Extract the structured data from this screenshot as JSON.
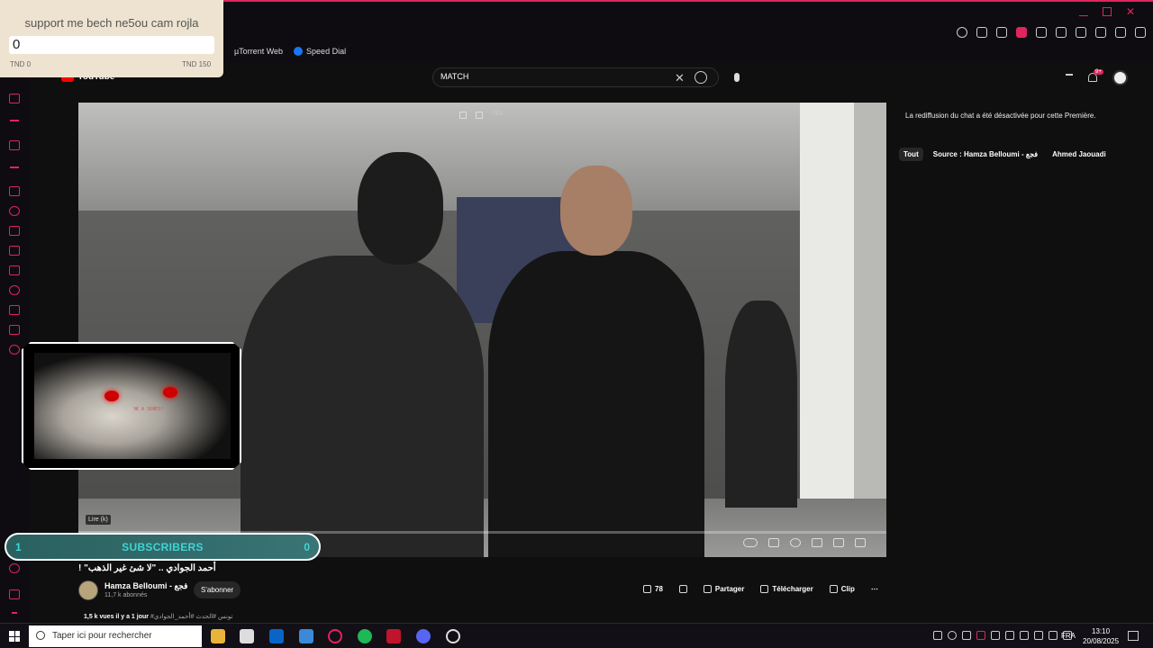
{
  "browser": {
    "bookmarks": [
      {
        "label": "µTorrent Web",
        "icon": "utorrent-icon"
      },
      {
        "label": "Speed Dial",
        "icon": "facebook-icon"
      }
    ]
  },
  "donation": {
    "title": "support me bech ne5ou cam rojla",
    "amount": "0",
    "min_label": "TND 0",
    "max_label": "TND 150"
  },
  "youtube": {
    "logo_text": "YouTube",
    "search_value": "MATCH",
    "notifications_badge": "9+"
  },
  "video": {
    "tooltip": "Lire (k)",
    "top_overlay_label": "ПЕХ",
    "title": "أحمد الجوادي .. \"لا شئ غير الذهب\" !",
    "views_line": "1,5 k vues  il y a 1 jour",
    "tags": "#تونس #الحدث #أحمد_الجوادي"
  },
  "channel": {
    "name": "Hamza Belloumi - فجع",
    "subs": "11,7 k abonnés",
    "subscribe_label": "S'abonner"
  },
  "actions": {
    "likes": "78",
    "share": "Partager",
    "download": "Télécharger",
    "clip": "Clip"
  },
  "chat": {
    "note": "La rediffusion du chat a été désactivée pour cette Première.",
    "chips": [
      "Tout",
      "Source : Hamza Belloumi - فجع",
      "Ahmed Jaouadi"
    ]
  },
  "stream_overlay": {
    "subs_left": "1",
    "subs_label": "SUBSCRIBERS",
    "subs_right": "0",
    "webcam_text": "ЭК А ЗОЯЕЗ?"
  },
  "taskbar": {
    "search_placeholder": "Taper ici pour rechercher",
    "language": "FRA",
    "time": "13:10",
    "date": "20/08/2025"
  },
  "colors": {
    "accent": "#e0245e",
    "subs_text": "#41d4d4"
  }
}
